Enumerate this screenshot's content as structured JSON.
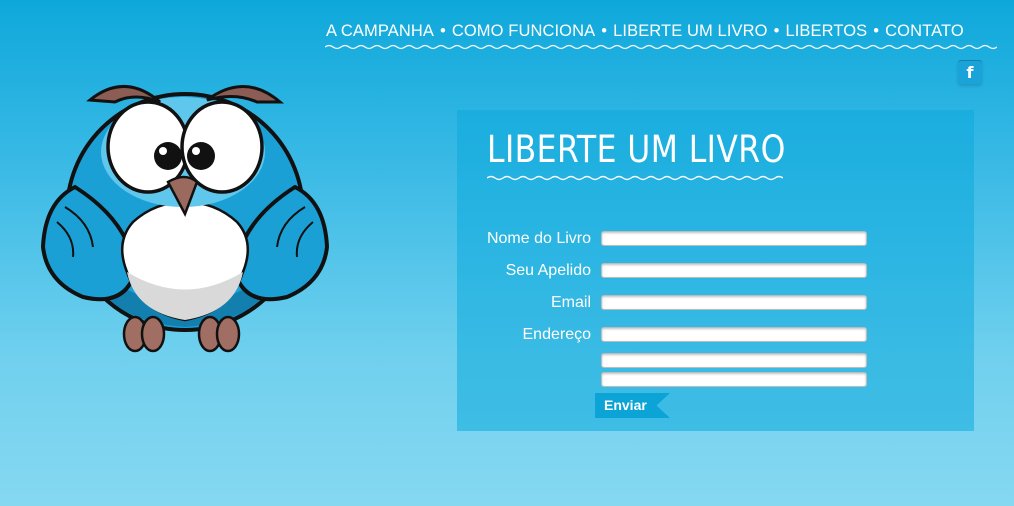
{
  "nav": {
    "items": [
      {
        "label": "A CAMPANHA"
      },
      {
        "label": "COMO FUNCIONA"
      },
      {
        "label": "LIBERTE UM LIVRO"
      },
      {
        "label": "LIBERTOS"
      },
      {
        "label": "CONTATO"
      }
    ],
    "separator": "•"
  },
  "social": {
    "facebook_glyph": "f",
    "icon": "facebook-icon"
  },
  "mascot": {
    "icon": "owl-mascot"
  },
  "form": {
    "title": "LIBERTE UM LIVRO",
    "fields": [
      {
        "label": "Nome do Livro",
        "value": ""
      },
      {
        "label": "Seu Apelido",
        "value": ""
      },
      {
        "label": "Email",
        "value": ""
      },
      {
        "label": "Endereço",
        "value": ""
      },
      {
        "label": "",
        "value": ""
      },
      {
        "label": "",
        "value": ""
      }
    ],
    "submit_label": "Enviar"
  },
  "colors": {
    "accent": "#0ca3d6",
    "panel": "#1cb3e2",
    "background_top": "#0ea8db",
    "background_bottom": "#86d8f1"
  }
}
